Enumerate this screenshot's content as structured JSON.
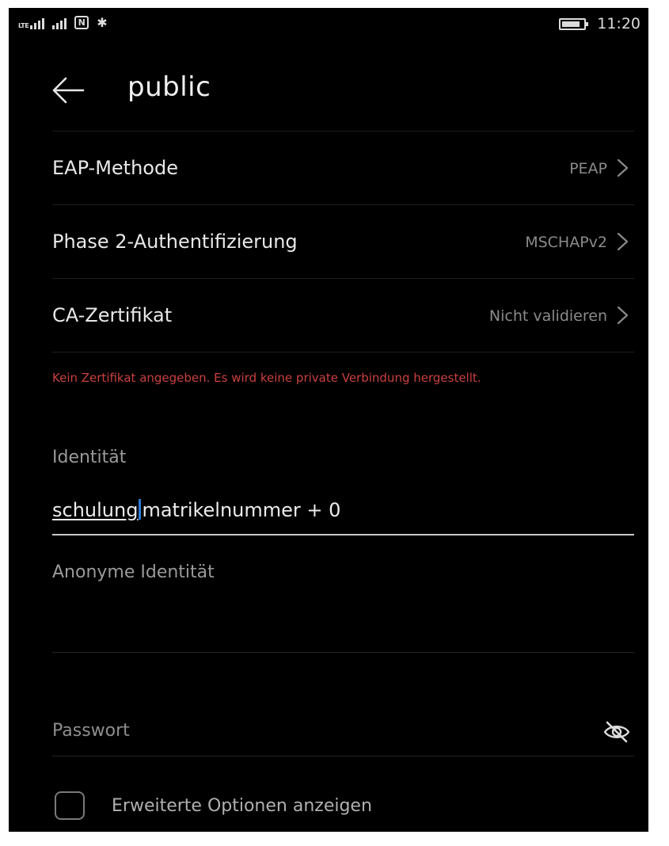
{
  "status_bar": {
    "network_type": "LTE",
    "time": "11:20",
    "icons": [
      "signal-icon",
      "signal-icon",
      "nfc-icon",
      "bluetooth-icon",
      "battery-icon"
    ]
  },
  "header": {
    "title": "public",
    "back_icon": "back-arrow-icon"
  },
  "settings": {
    "eap_method": {
      "label": "EAP-Methode",
      "value": "PEAP"
    },
    "phase2_auth": {
      "label": "Phase 2-Authentifizierung",
      "value": "MSCHAPv2"
    },
    "ca_certificate": {
      "label": "CA-Zertifikat",
      "value": "Nicht validieren"
    }
  },
  "warning": "Kein Zertifikat angegeben. Es wird keine private Verbindung hergestellt.",
  "identity": {
    "label": "Identität",
    "value_typed": "schulung",
    "value_rest": "matrikelnummer + 0"
  },
  "anonymous_identity": {
    "label": "Anonyme Identität",
    "value": ""
  },
  "password": {
    "placeholder": "Passwort",
    "visibility_icon": "eye-off-icon"
  },
  "advanced_options": {
    "label": "Erweiterte Optionen anzeigen",
    "checked": false
  },
  "colors": {
    "background": "#000000",
    "warning": "#c8413f",
    "caret": "#2d7bd6"
  }
}
